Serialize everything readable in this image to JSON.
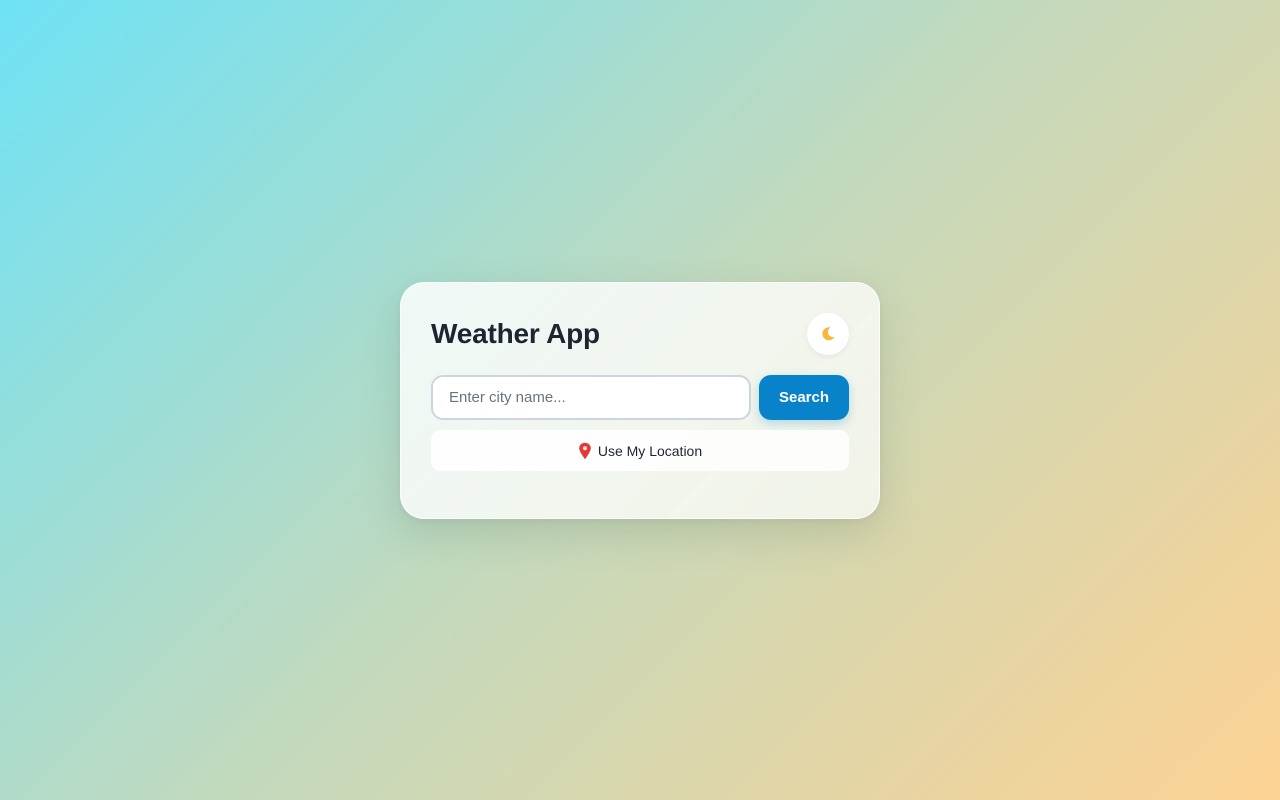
{
  "app": {
    "title": "Weather App"
  },
  "theme_toggle": {
    "icon": "moon-icon"
  },
  "search": {
    "placeholder": "Enter city name...",
    "value": "",
    "button_label": "Search"
  },
  "location": {
    "icon": "map-pin-icon",
    "label": "Use My Location"
  },
  "colors": {
    "accent": "#0882c8",
    "pin": "#e53935",
    "moon": "#f5b83a",
    "background_start": "#6ee2f5",
    "background_end": "#fdd293"
  }
}
